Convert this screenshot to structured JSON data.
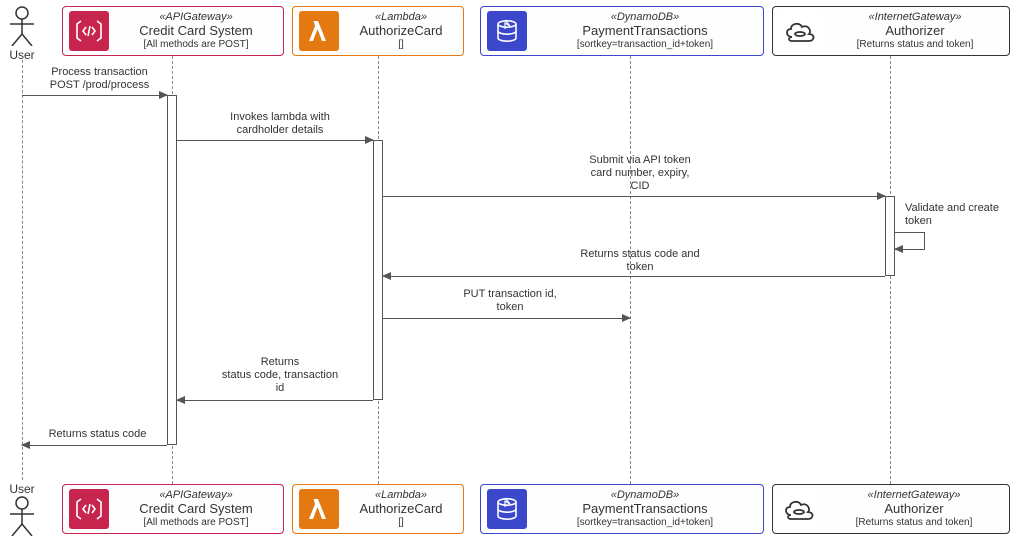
{
  "actors": {
    "user": {
      "label": "User"
    }
  },
  "participants": {
    "apigw": {
      "stereotype": "«APIGateway»",
      "name": "Credit Card System",
      "note": "[All methods are POST]",
      "border": "#C7254E",
      "iconbg": "#C7254E"
    },
    "lambda": {
      "stereotype": "«Lambda»",
      "name": "AuthorizeCard",
      "note": "[]",
      "border": "#E47911",
      "iconbg": "#E47911"
    },
    "ddb": {
      "stereotype": "«DynamoDB»",
      "name": "PaymentTransactions",
      "note": "[sortkey=transaction_id+token]",
      "border": "#3B48CC",
      "iconbg": "#3B48CC"
    },
    "igw": {
      "stereotype": "«InternetGateway»",
      "name": "Authorizer",
      "note": "[Returns status and token]",
      "border": "#333333",
      "iconbg": "#ffffff"
    }
  },
  "messages": {
    "m1": "Process transaction\nPOST /prod/process",
    "m2": "Invokes lambda with\ncardholder details",
    "m3": "Submit via API token\ncard number, expiry,\nCID",
    "m4": "Validate and create\ntoken",
    "m5": "Returns status code and\ntoken",
    "m6": "PUT transaction id,\ntoken",
    "m7": "Returns\nstatus code, transaction\nid",
    "m8": "Returns status code"
  },
  "chart_data": {
    "type": "sequence-diagram",
    "participants": [
      {
        "id": "user",
        "kind": "actor",
        "label": "User"
      },
      {
        "id": "apigw",
        "kind": "APIGateway",
        "label": "Credit Card System",
        "note": "All methods are POST"
      },
      {
        "id": "lambda",
        "kind": "Lambda",
        "label": "AuthorizeCard",
        "note": ""
      },
      {
        "id": "ddb",
        "kind": "DynamoDB",
        "label": "PaymentTransactions",
        "note": "sortkey=transaction_id+token"
      },
      {
        "id": "igw",
        "kind": "InternetGateway",
        "label": "Authorizer",
        "note": "Returns status and token"
      }
    ],
    "messages": [
      {
        "from": "user",
        "to": "apigw",
        "text": "Process transaction POST /prod/process",
        "return": false
      },
      {
        "from": "apigw",
        "to": "lambda",
        "text": "Invokes lambda with cardholder details",
        "return": false
      },
      {
        "from": "lambda",
        "to": "igw",
        "text": "Submit via API token card number, expiry, CID",
        "return": false
      },
      {
        "from": "igw",
        "to": "igw",
        "text": "Validate and create token",
        "return": false,
        "self": true
      },
      {
        "from": "igw",
        "to": "lambda",
        "text": "Returns status code and token",
        "return": true
      },
      {
        "from": "lambda",
        "to": "ddb",
        "text": "PUT transaction id, token",
        "return": false
      },
      {
        "from": "lambda",
        "to": "apigw",
        "text": "Returns status code, transaction id",
        "return": true
      },
      {
        "from": "apigw",
        "to": "user",
        "text": "Returns status code",
        "return": true
      }
    ]
  }
}
